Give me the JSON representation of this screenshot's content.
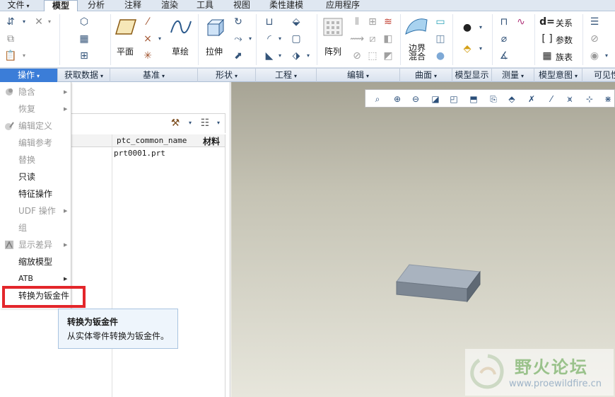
{
  "tabs": [
    {
      "label": "文件",
      "caret": "▾"
    },
    {
      "label": "模型",
      "active": true
    },
    {
      "label": "分析"
    },
    {
      "label": "注释"
    },
    {
      "label": "渲染"
    },
    {
      "label": "工具"
    },
    {
      "label": "视图"
    },
    {
      "label": "柔性建模"
    },
    {
      "label": "应用程序"
    }
  ],
  "ribbon": {
    "plane_label": "平面",
    "sketch_label": "草绘",
    "extrude_label": "拉伸",
    "pattern_label": "阵列",
    "boundary_blend_label": "边界\n混合",
    "relations_label": "关系",
    "params_label": "参数",
    "family_table_label": "族表"
  },
  "groups": [
    {
      "label": "操作",
      "selected": true
    },
    {
      "label": "获取数据"
    },
    {
      "label": "基准"
    },
    {
      "label": "形状"
    },
    {
      "label": "工程"
    },
    {
      "label": "编辑"
    },
    {
      "label": "曲面"
    },
    {
      "label": "模型显示"
    },
    {
      "label": "测量"
    },
    {
      "label": "模型意图"
    },
    {
      "label": "可见性"
    }
  ],
  "tree": {
    "col1": "ptc_common_name",
    "col2": "材料",
    "row1": "prt0001.prt"
  },
  "menu": [
    {
      "label": "隐含",
      "disabled": true,
      "submenu": true,
      "icon": "suppress-icon"
    },
    {
      "label": "恢复",
      "disabled": true,
      "submenu": true
    },
    {
      "label": "编辑定义",
      "disabled": true,
      "icon": "edit-definition-icon"
    },
    {
      "label": "编辑参考",
      "disabled": true
    },
    {
      "label": "替换",
      "disabled": true
    },
    {
      "label": "只读"
    },
    {
      "label": "特征操作"
    },
    {
      "label": "UDF 操作",
      "disabled": true,
      "submenu": true
    },
    {
      "label": "组",
      "disabled": true
    },
    {
      "label": "显示差异",
      "disabled": true,
      "submenu": true,
      "icon": "compare-icon"
    },
    {
      "label": "缩放模型"
    },
    {
      "label": "ATB",
      "submenu": true
    },
    {
      "label": "转换为钣金件",
      "highlighted": true
    }
  ],
  "tooltip": {
    "title": "转换为钣金件",
    "description": "从实体零件转换为钣金件。"
  },
  "watermark": {
    "name": "野火论坛",
    "url": "www.proewildfire.cn"
  },
  "colors": {
    "accent": "#3b7dd8",
    "highlight_box": "#e3262b",
    "viewport_top": "#a7a495",
    "viewport_bottom": "#e7e6dc",
    "part_top": "#a9b3bf",
    "part_side": "#7d8793"
  }
}
